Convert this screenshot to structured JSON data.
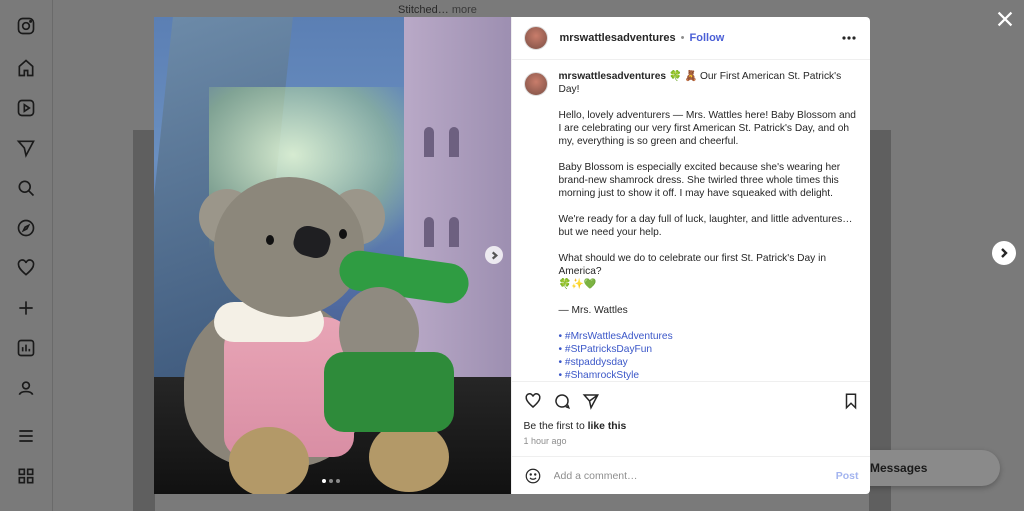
{
  "background": {
    "snippet": "Stitched…",
    "snippet_more": "more",
    "messages_label": "Messages"
  },
  "post": {
    "username": "mrswattlesadventures",
    "separator": "•",
    "follow_label": "Follow",
    "caption": {
      "username": "mrswattlesadventures",
      "title": "🍀 🧸 Our First American St. Patrick's Day!",
      "paragraphs": [
        "Hello, lovely adventurers — Mrs. Wattles here! Baby Blossom and I are celebrating our very first American St. Patrick's Day, and oh my, everything is so green and cheerful.",
        "Baby Blossom is especially excited because she's wearing her brand-new shamrock dress. She twirled three whole times this morning just to show it off. I may have squeaked with delight.",
        "We're ready for a day full of luck, laughter, and little adventures… but we need your help.",
        "What should we do to celebrate our first St. Patrick's Day in America?\n🍀✨💚",
        "— Mrs. Wattles"
      ],
      "hashtags": [
        "• #MrsWattlesAdventures",
        "• #StPatricksDayFun",
        "• #stpaddysday",
        "• #ShamrockStyle"
      ]
    },
    "likes_prefix": "Be the first to ",
    "likes_action": "like this",
    "timestamp": "1 hour ago",
    "comment_placeholder": "Add a comment…",
    "post_label": "Post",
    "media_count": 3,
    "media_active_index": 0
  },
  "icons": {
    "sidebar": [
      "instagram-icon",
      "home-icon",
      "reels-icon",
      "messages-icon",
      "search-icon",
      "explore-icon",
      "notifications-icon",
      "create-icon",
      "dashboard-icon",
      "profile-icon",
      "menu-icon",
      "also-from-meta-icon"
    ],
    "actions": [
      "heart-icon",
      "comment-icon",
      "share-icon",
      "bookmark-icon"
    ]
  }
}
